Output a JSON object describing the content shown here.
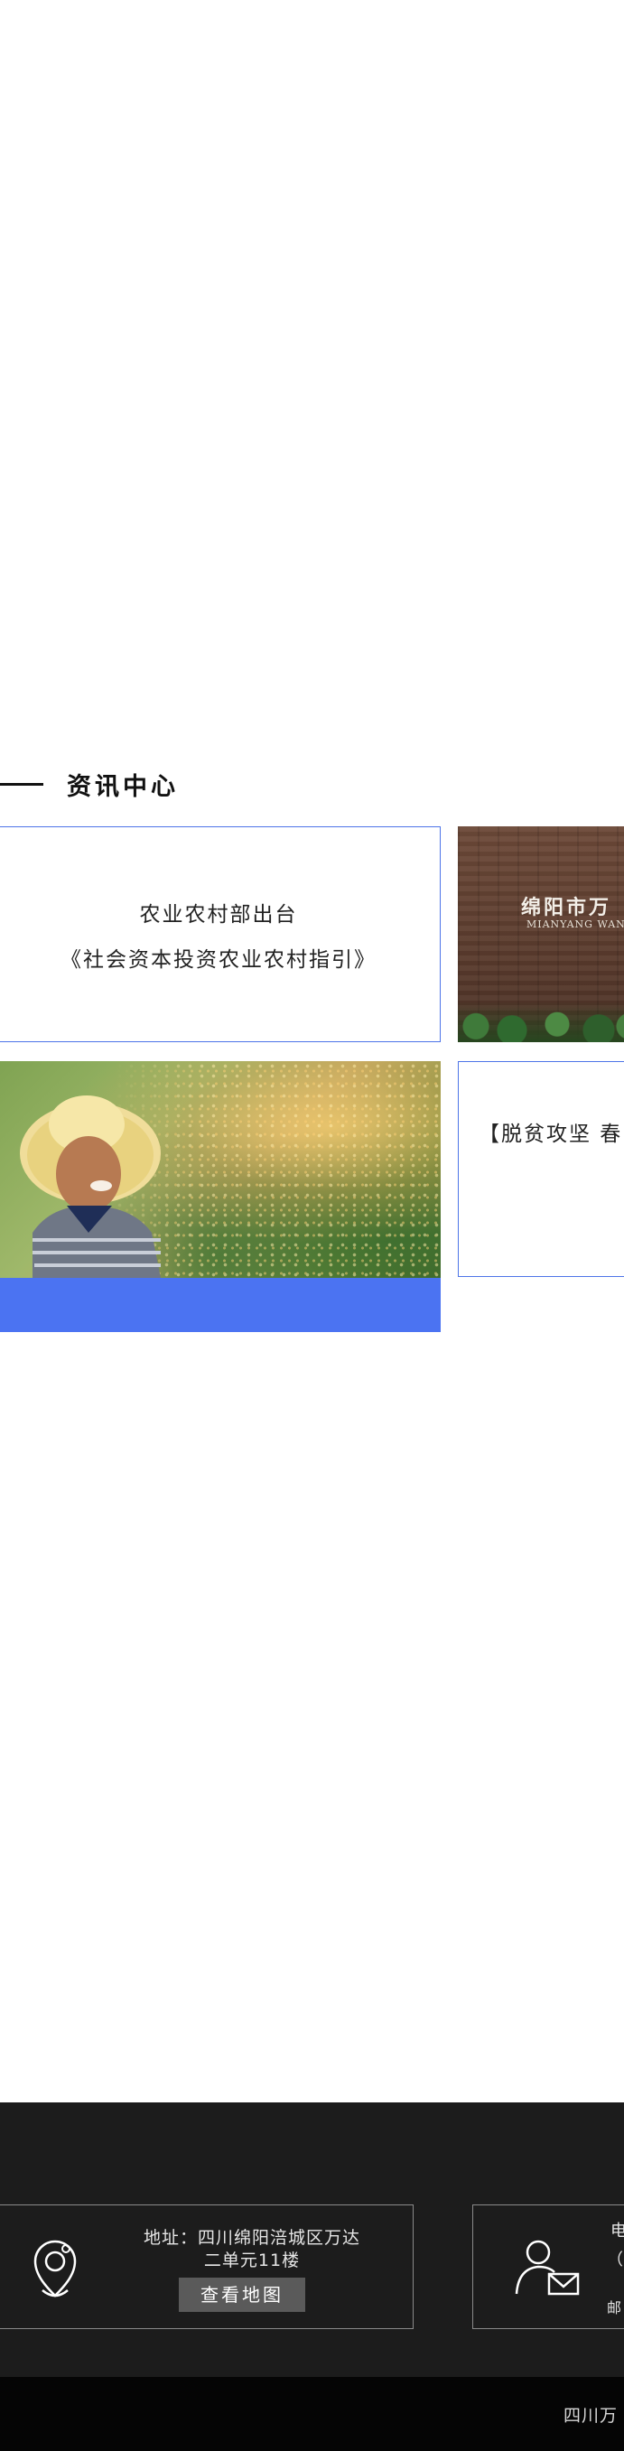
{
  "news_section": {
    "title": "资讯中心",
    "items": [
      {
        "line1": "农业农村部出台",
        "line2": "《社会资本投资农业农村指引》"
      },
      {
        "sign_cn": "绵阳市万",
        "sign_en": "MIANYANG WAN"
      },
      {
        "image": "farmer-photo"
      },
      {
        "text": "【脱贫攻坚 春"
      }
    ]
  },
  "footer": {
    "address_label": "地址：四川绵阳涪城区万达",
    "address_line2": "二单元11楼",
    "map_button": "查看地图",
    "contact_line1": "电",
    "contact_line2": "（",
    "contact_line3": "邮",
    "icons": {
      "address": "location-pin-icon",
      "contact": "user-mail-icon"
    }
  },
  "copyright": {
    "text": "四川万"
  },
  "colors": {
    "accent": "#4b73f2",
    "footer_bg": "#1c1c1c",
    "copyright_bg": "#050505"
  }
}
